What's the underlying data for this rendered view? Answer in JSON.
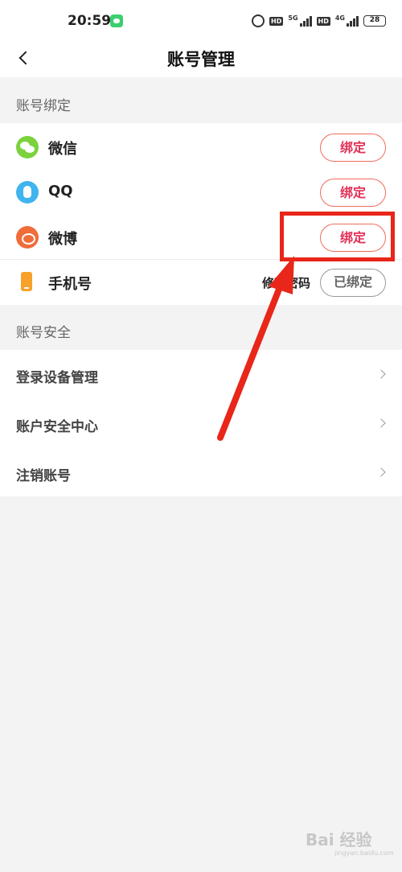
{
  "status_bar": {
    "time": "20:59",
    "network_label_1": "5G",
    "network_label_2": "4G",
    "hd_label": "HD",
    "battery": "28"
  },
  "header": {
    "title": "账号管理"
  },
  "sections": {
    "binding_title": "账号绑定",
    "security_title": "账号安全"
  },
  "bindings": [
    {
      "label": "微信",
      "icon": "wechat-icon",
      "button": "绑定"
    },
    {
      "label": "QQ",
      "icon": "qq-icon",
      "button": "绑定"
    },
    {
      "label": "微博",
      "icon": "weibo-icon",
      "button": "绑定"
    }
  ],
  "phone": {
    "label": "手机号",
    "icon": "phone-icon",
    "change_password": "修改密码",
    "status_button": "已绑定"
  },
  "security_items": [
    {
      "label": "登录设备管理"
    },
    {
      "label": "账户安全中心"
    },
    {
      "label": "注销账号"
    }
  ],
  "watermark": {
    "text": "Bai 经验",
    "sub": "jingyan.baidu.com"
  },
  "colors": {
    "accent": "#e23158",
    "annotation": "#e8261a"
  }
}
